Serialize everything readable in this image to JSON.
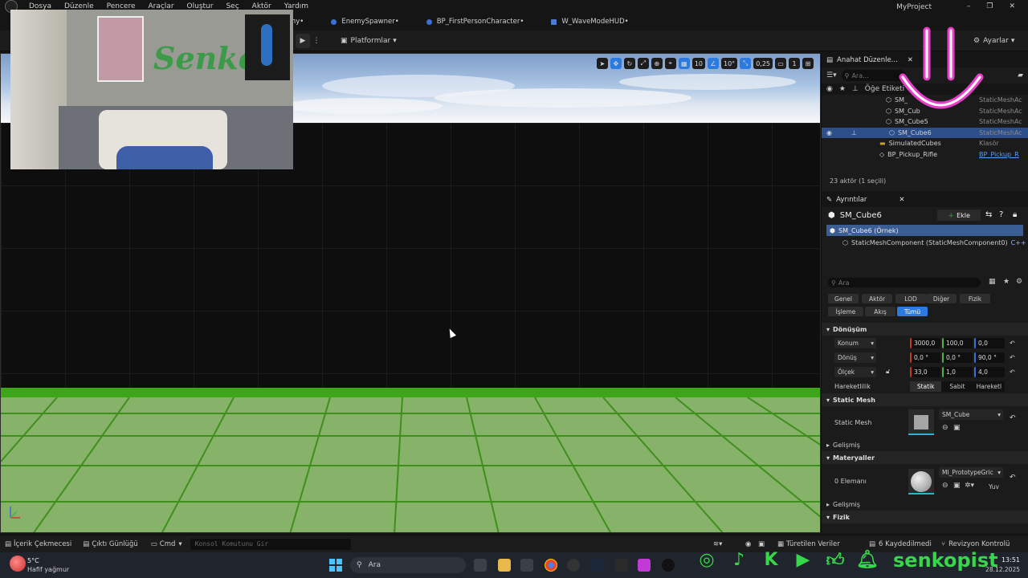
{
  "menu": [
    "Dosya",
    "Düzenle",
    "Pencere",
    "Araçlar",
    "Oluştur",
    "Seç",
    "Aktör",
    "Yardım"
  ],
  "project_name": "MyProject",
  "tabs": [
    {
      "label": "my•"
    },
    {
      "label": "EnemySpawner•"
    },
    {
      "label": "BP_FirstPersonCharacter•"
    },
    {
      "label": "W_WaveModeHUD•"
    }
  ],
  "toolbar": {
    "platforms": "Platformlar",
    "settings": "Ayarlar"
  },
  "viewport": {
    "grid_value": "10",
    "angle_value": "10°",
    "scale_value": "0,25",
    "camera_value": "1",
    "webcam_sign": "Senko"
  },
  "outliner": {
    "tab_title": "Anahat Düzenle...",
    "search_placeholder": "Ara...",
    "column_label": "Öğe Etiketi",
    "rows": [
      {
        "name": "SM_",
        "type": "StaticMeshAc"
      },
      {
        "name": "SM_Cub",
        "type": "StaticMeshAc"
      },
      {
        "name": "SM_Cube5",
        "type": "StaticMeshAc"
      },
      {
        "name": "SM_Cube6",
        "type": "StaticMeshAc"
      },
      {
        "name": "SimulatedCubes",
        "type": "Klasör"
      },
      {
        "name": "BP_Pickup_Rifle",
        "type": "BP_Pickup_R"
      }
    ],
    "status": "23 aktör (1 seçili)"
  },
  "details": {
    "tab_title": "Ayrıntılar",
    "object_name": "SM_Cube6",
    "add_button": "Ekle",
    "instance_label": "SM_Cube6 (Örnek)",
    "component_label": "StaticMeshComponent (StaticMeshComponent0)",
    "component_lang": "C++",
    "search_placeholder": "Ara",
    "filters_row1": [
      "Genel",
      "Aktör",
      "LOD",
      "Diğer",
      "Fizik"
    ],
    "filters_row2": [
      "İşleme",
      "Akış",
      "Tümü"
    ],
    "transform_header": "Dönüşüm",
    "location": {
      "label": "Konum",
      "x": "3000,0",
      "y": "100,0",
      "z": "0,0"
    },
    "rotation": {
      "label": "Dönüş",
      "x": "0,0 °",
      "y": "0,0 °",
      "z": "90,0 °"
    },
    "scale": {
      "label": "Ölçek",
      "x": "33,0",
      "y": "1,0",
      "z": "4,0"
    },
    "mobility_label": "Hareketlilik",
    "mobility_options": [
      "Statik",
      "Sabit",
      "Hareketl"
    ],
    "static_mesh_header": "Static Mesh",
    "static_mesh_label": "Static Mesh",
    "static_mesh_value": "SM_Cube",
    "advanced_label": "Gelişmiş",
    "materials_header": "Materyaller",
    "elements_label": "0 Elemanı",
    "material_value": "MI_PrototypeGric",
    "material_extra": "Yuv",
    "advanced_label2": "Gelişmiş",
    "physics_header": "Fizik"
  },
  "bottombar": {
    "content_drawer": "İçerik Çekmecesi",
    "output_log": "Çıktı Günlüğü",
    "cmd": "Cmd",
    "console_placeholder": "Konsol Komutunu Gir",
    "derived_data": "Türetilen Veriler",
    "saved": "6 Kaydedilmedi",
    "revision": "Revizyon Kontrolü"
  },
  "taskbar": {
    "weather_temp": "5°C",
    "weather_desc": "Hafif yağmur",
    "search": "Ara",
    "time": "13:51",
    "date": "28.12.2025"
  },
  "overlay": {
    "handle": "senkopist"
  }
}
